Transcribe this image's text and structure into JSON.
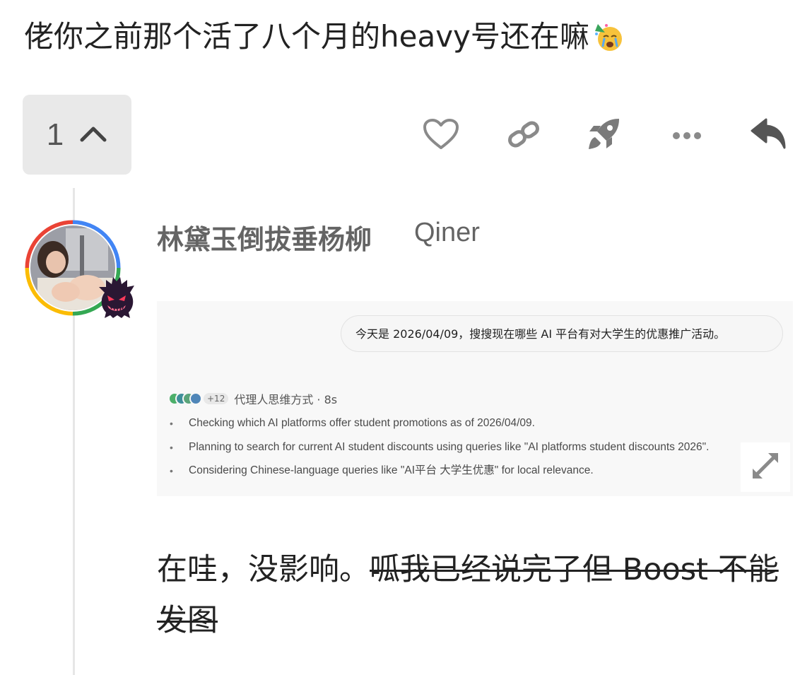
{
  "post": {
    "text": "佬你之前那个活了八个月的heavy号还在嘛",
    "emoji": "crying-party-face-emoji"
  },
  "controls": {
    "like_count": "1",
    "icons": [
      "chevron-up-icon",
      "heart-icon",
      "link-icon",
      "rocket-icon",
      "more-icon",
      "reply-icon"
    ],
    "accent_gray": "#646464"
  },
  "reply": {
    "username": "林黛玉倒拔垂杨柳",
    "handle": "Qiner",
    "avatar_ring_colors": [
      "#ea4335",
      "#fbbc05",
      "#34a853",
      "#4285f4"
    ],
    "flair": "ghost-flair-icon",
    "screenshot": {
      "user_message": "今天是 2026/04/09，搜搜现在哪些 AI 平台有对大学生的优惠推广活动。",
      "agents_extra": "+12",
      "agents_label": "代理人思维方式 · 8s",
      "thinking_steps": [
        "Checking which AI platforms offer student promotions as of 2026/04/09.",
        "Planning to search for current AI student discounts using queries like \"AI platforms student discounts 2026\".",
        "Considering Chinese-language queries like \"AI平台 大学生优惠\" for local relevance."
      ]
    },
    "body_plain": "在哇，没影响。",
    "body_struck": "呱我已经说完了但 Boost 不能发图"
  }
}
